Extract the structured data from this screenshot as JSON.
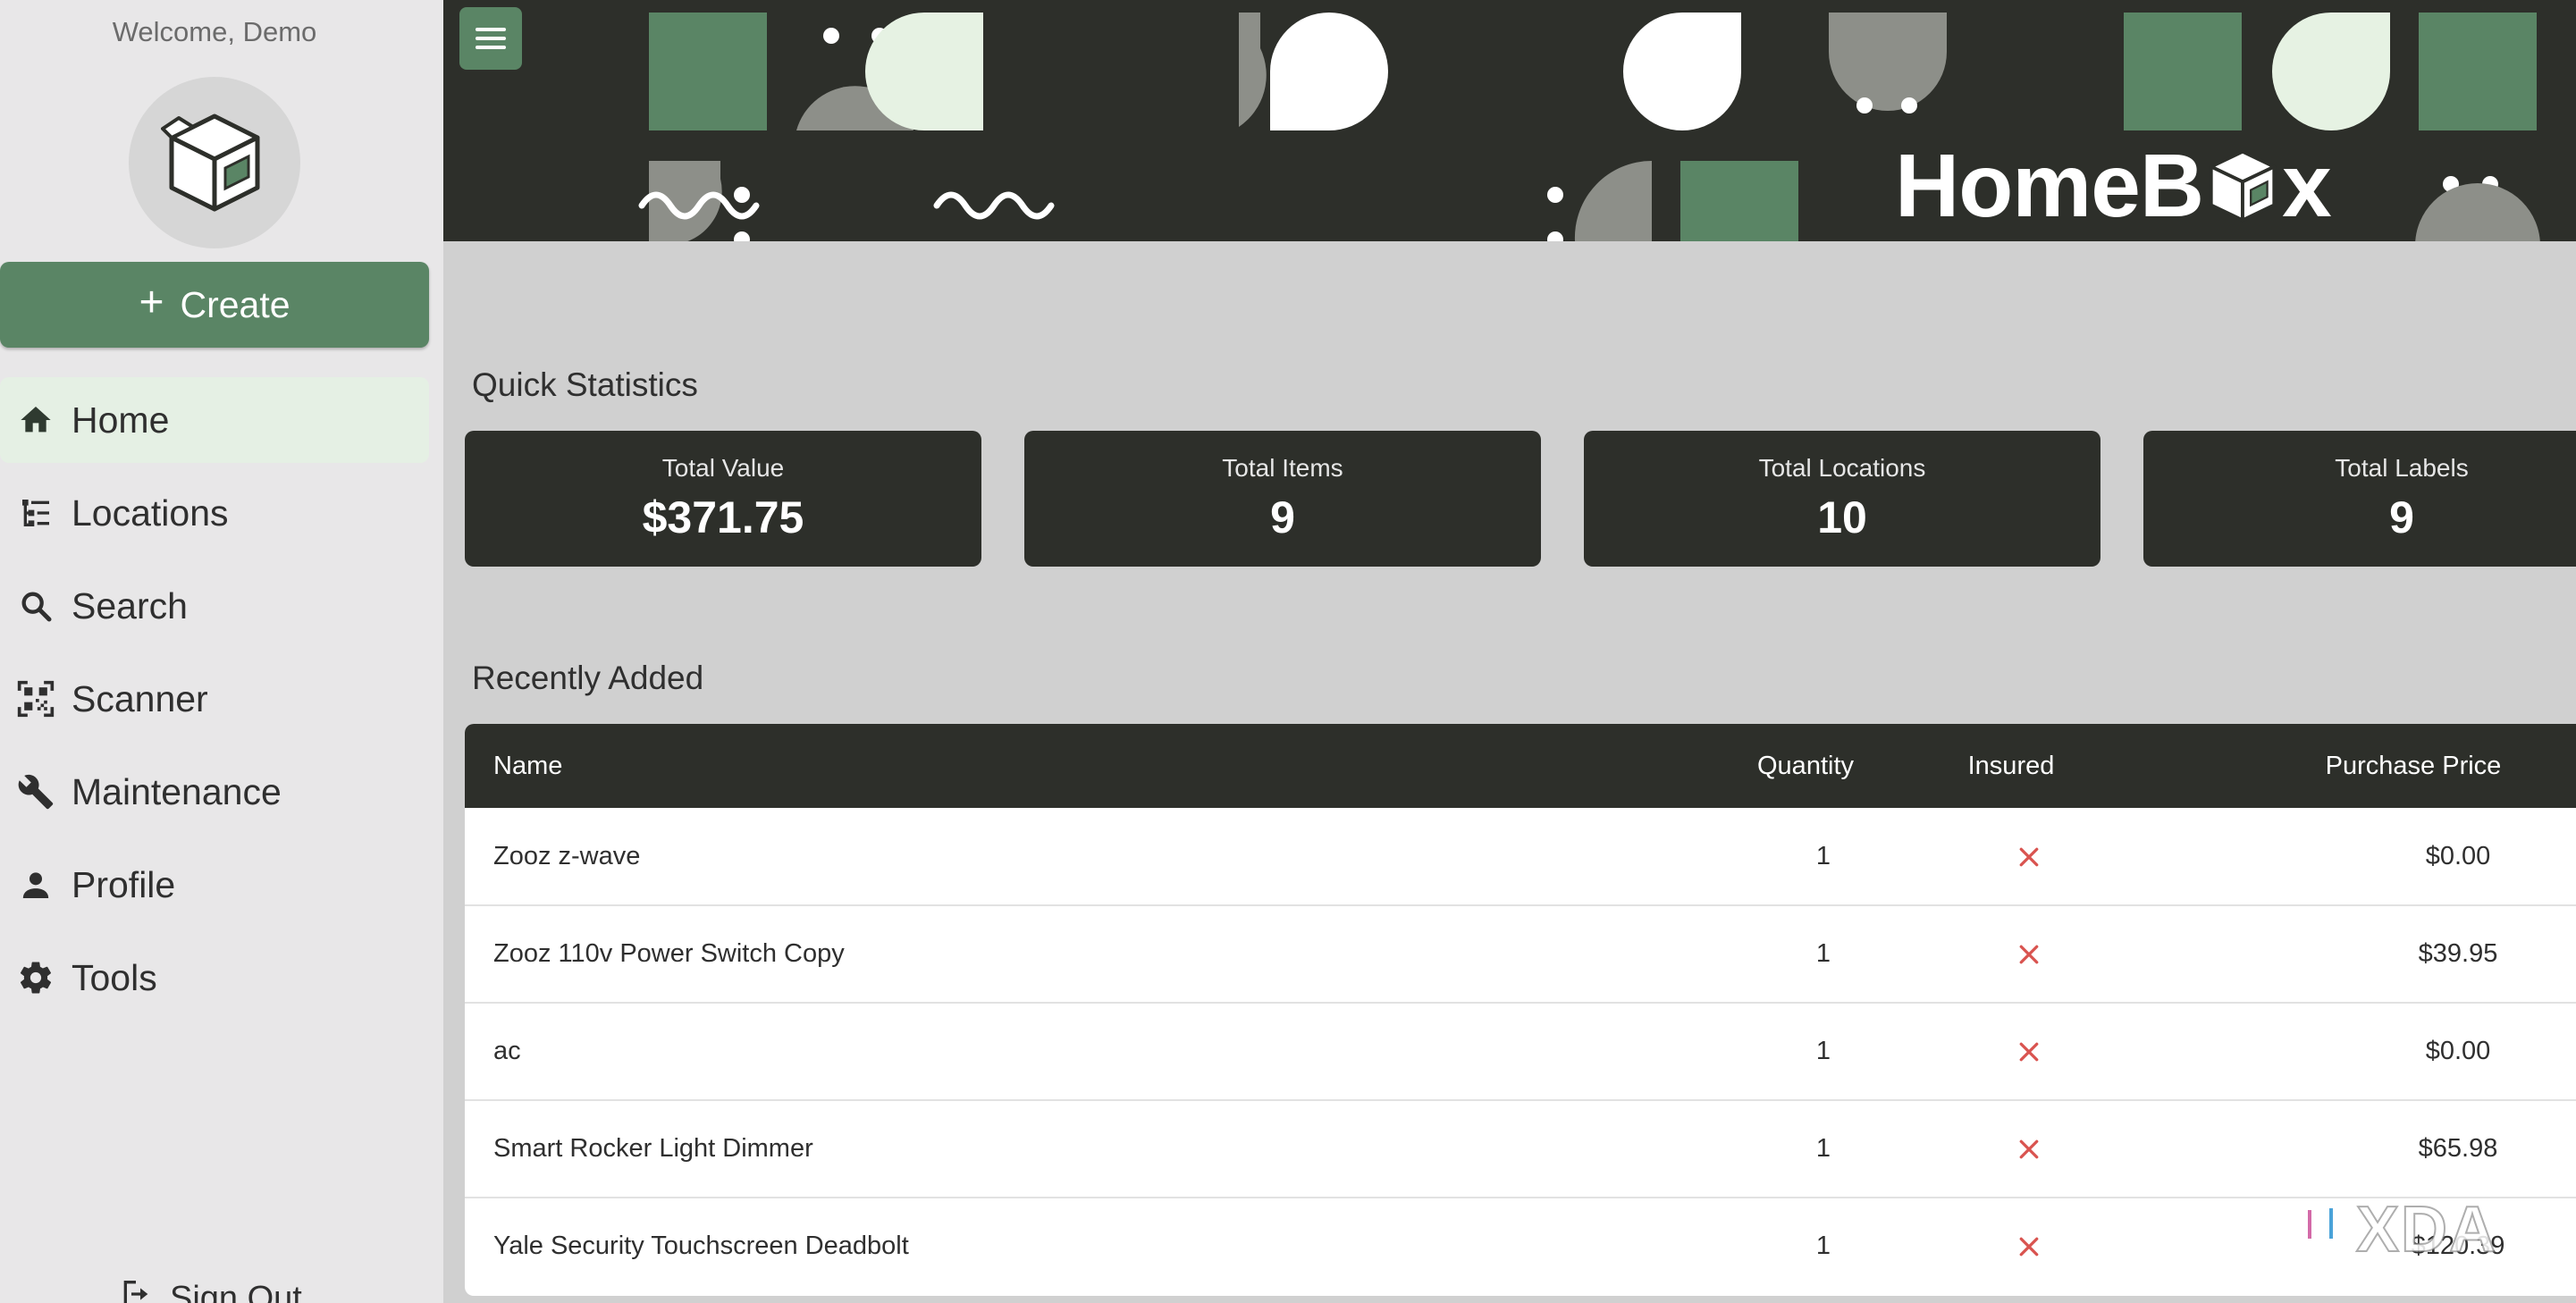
{
  "sidebar": {
    "welcome": "Welcome, Demo",
    "create_label": "Create",
    "items": [
      {
        "label": "Home",
        "icon": "home-icon",
        "active": true
      },
      {
        "label": "Locations",
        "icon": "tree-icon",
        "active": false
      },
      {
        "label": "Search",
        "icon": "search-icon",
        "active": false
      },
      {
        "label": "Scanner",
        "icon": "qr-code-icon",
        "active": false
      },
      {
        "label": "Maintenance",
        "icon": "wrench-icon",
        "active": false
      },
      {
        "label": "Profile",
        "icon": "user-icon",
        "active": false
      },
      {
        "label": "Tools",
        "icon": "gear-icon",
        "active": false
      }
    ],
    "signout_label": "Sign Out"
  },
  "header": {
    "brand": "HomeBox",
    "brand_before": "HomeB",
    "brand_after": "x"
  },
  "quick_stats": {
    "title": "Quick Statistics",
    "cards": [
      {
        "label": "Total Value",
        "value": "$371.75"
      },
      {
        "label": "Total Items",
        "value": "9"
      },
      {
        "label": "Total Locations",
        "value": "10"
      },
      {
        "label": "Total Labels",
        "value": "9"
      }
    ]
  },
  "recent": {
    "title": "Recently Added",
    "columns": [
      "Name",
      "Quantity",
      "Insured",
      "Purchase Price"
    ],
    "rows": [
      {
        "name": "Zooz z-wave",
        "quantity": "1",
        "insured": false,
        "price": "$0.00"
      },
      {
        "name": "Zooz 110v Power Switch Copy",
        "quantity": "1",
        "insured": false,
        "price": "$39.95"
      },
      {
        "name": "ac",
        "quantity": "1",
        "insured": false,
        "price": "$0.00"
      },
      {
        "name": "Smart Rocker Light Dimmer",
        "quantity": "1",
        "insured": false,
        "price": "$65.98"
      },
      {
        "name": "Yale Security Touchscreen Deadbolt",
        "quantity": "1",
        "insured": false,
        "price": "$120.39"
      }
    ]
  },
  "watermark": "XDA",
  "colors": {
    "accent": "#5a8565",
    "dark": "#2d2f2a",
    "sidebar_bg": "#e8e7e8",
    "active_bg": "#e5f0e4",
    "main_bg": "#d0d0d0",
    "not_insured": "#d9534f"
  }
}
